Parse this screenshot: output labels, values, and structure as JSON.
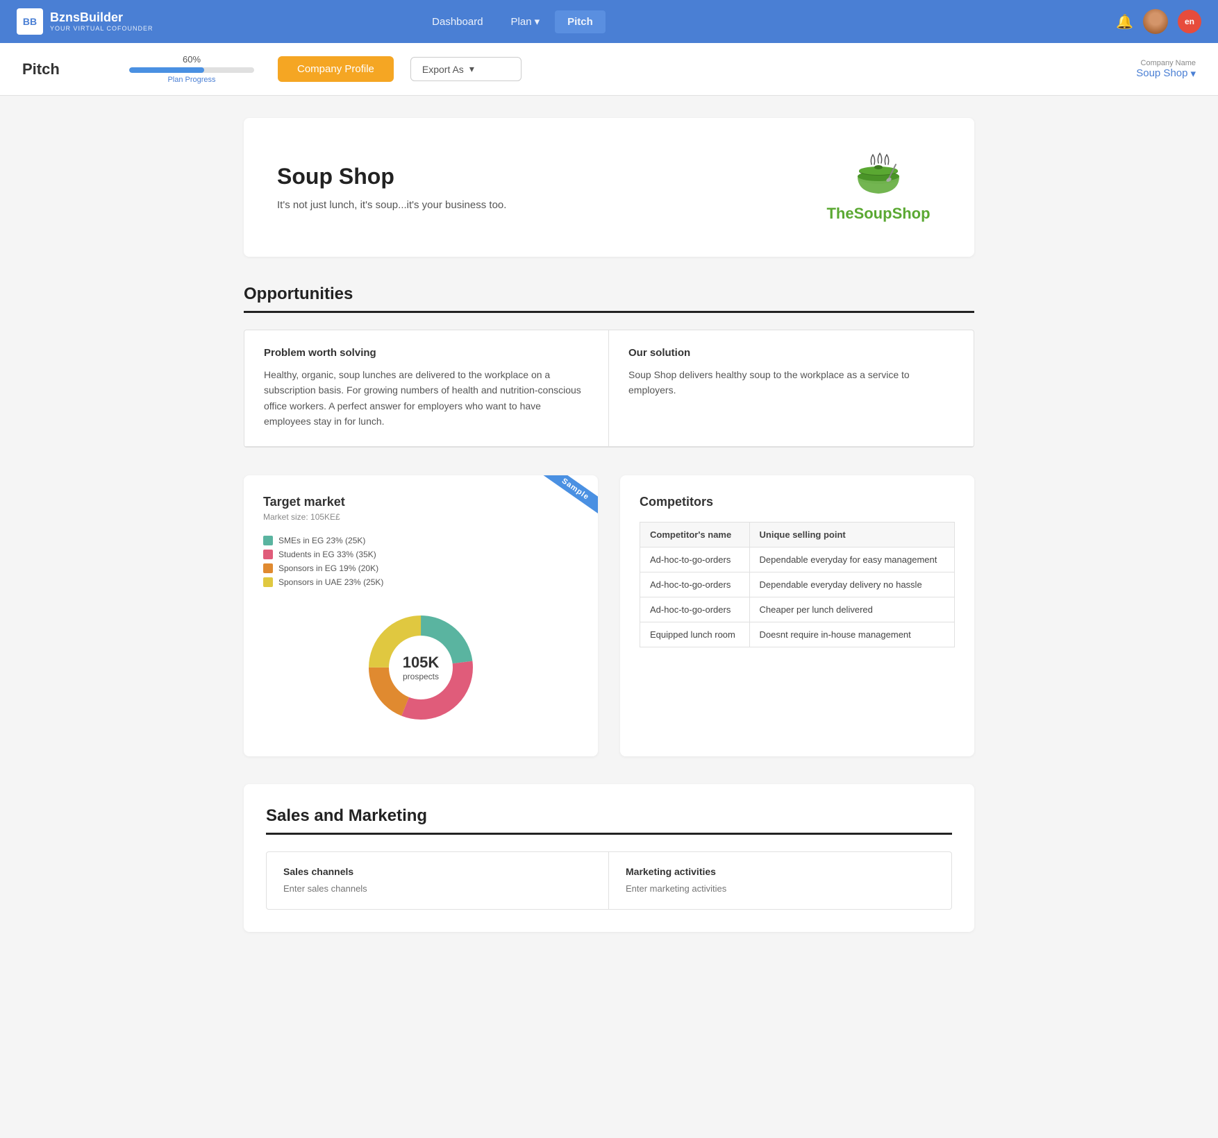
{
  "brand": {
    "icon": "BB",
    "name": "BznsBuilder",
    "sub": "YOUR VIRTUAL COFOUNDER"
  },
  "nav": {
    "links": [
      {
        "label": "Dashboard",
        "active": false
      },
      {
        "label": "Plan",
        "active": false,
        "hasDropdown": true
      },
      {
        "label": "Pitch",
        "active": true
      }
    ]
  },
  "user": {
    "lang": "en"
  },
  "subheader": {
    "pageTitle": "Pitch",
    "progress": {
      "pct": "60%",
      "label": "Plan Progress",
      "fill": 60
    },
    "companyProfileBtn": "Company Profile",
    "exportLabel": "Export As",
    "companyNameLabel": "Company Name",
    "companyName": "Soup Shop"
  },
  "hero": {
    "title": "Soup Shop",
    "subtitle": "It's not just lunch, it's soup...it's your business too.",
    "logoTextPart1": "The",
    "logoTextGreen": "Soup",
    "logoTextPart2": "Shop"
  },
  "opportunities": {
    "sectionTitle": "Opportunities",
    "cells": [
      {
        "label": "Problem worth solving",
        "text": "Healthy, organic, soup lunches are delivered to the workplace on a subscription basis. For growing numbers of health and nutrition-conscious office workers. A perfect answer for employers who want to have employees stay in for lunch."
      },
      {
        "label": "Our solution",
        "text": "Soup Shop delivers healthy soup to the workplace as a service to employers."
      }
    ]
  },
  "targetMarket": {
    "title": "Target market",
    "marketSize": "Market size: 105KE£",
    "sampleBadge": "Sample",
    "legend": [
      {
        "color": "#5ab4a0",
        "label": "SMEs in EG 23% (25K)"
      },
      {
        "color": "#e05c7a",
        "label": "Students in EG 33% (35K)"
      },
      {
        "color": "#e08a30",
        "label": "Sponsors in EG 19% (20K)"
      },
      {
        "color": "#e0c840",
        "label": "Sponsors in UAE 23% (25K)"
      }
    ],
    "donutCenter": "105K",
    "donutLabel": "prospects",
    "segments": [
      {
        "color": "#5ab4a0",
        "pct": 23
      },
      {
        "color": "#e05c7a",
        "pct": 33
      },
      {
        "color": "#e08a30",
        "pct": 19
      },
      {
        "color": "#e0c840",
        "pct": 25
      }
    ]
  },
  "competitors": {
    "title": "Competitors",
    "headers": [
      "Competitor's name",
      "Unique selling point"
    ],
    "rows": [
      {
        "name": "Ad-hoc-to-go-orders",
        "usp": "Dependable everyday for easy management"
      },
      {
        "name": "Ad-hoc-to-go-orders",
        "usp": "Dependable everyday delivery no hassle"
      },
      {
        "name": "Ad-hoc-to-go-orders",
        "usp": "Cheaper per lunch delivered"
      },
      {
        "name": "Equipped lunch room",
        "usp": "Doesnt require in-house management"
      }
    ]
  },
  "salesMarketing": {
    "sectionTitle": "Sales and Marketing",
    "salesChannelsLabel": "Sales channels",
    "salesChannelsPlaceholder": "Enter sales channels",
    "marketingActivitiesLabel": "Marketing activities",
    "marketingActivitiesPlaceholder": "Enter marketing activities"
  }
}
